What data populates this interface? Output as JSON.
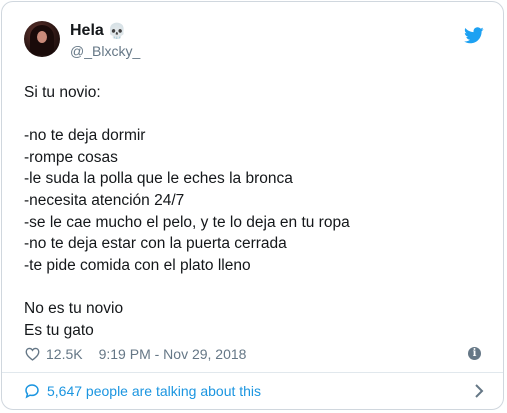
{
  "author": {
    "display_name": "Hela",
    "name_emoji": "💀",
    "handle": "@_Blxcky_"
  },
  "tweet": {
    "lines": [
      "Si tu novio:",
      "",
      "-no te deja dormir",
      "-rompe cosas",
      "-le suda la polla que le eches la bronca",
      "-necesita atención 24/7",
      "-se le cae mucho el pelo, y te lo deja en tu ropa",
      "-no te deja estar con la puerta cerrada",
      "-te pide comida con el plato lleno",
      "",
      "No es tu novio",
      "Es tu gato"
    ]
  },
  "meta": {
    "likes": "12.5K",
    "timestamp": "9:19 PM - Nov 29, 2018"
  },
  "footer": {
    "talking": "5,647 people are talking about this"
  },
  "icons": {
    "bird": "twitter-bird-icon",
    "heart": "heart-icon",
    "info": "info-icon",
    "bubble": "speech-bubble-icon",
    "chevron": "chevron-right-icon"
  },
  "colors": {
    "brand_blue": "#1da1f2",
    "link_blue": "#1b95e0",
    "secondary_text": "#657786"
  }
}
